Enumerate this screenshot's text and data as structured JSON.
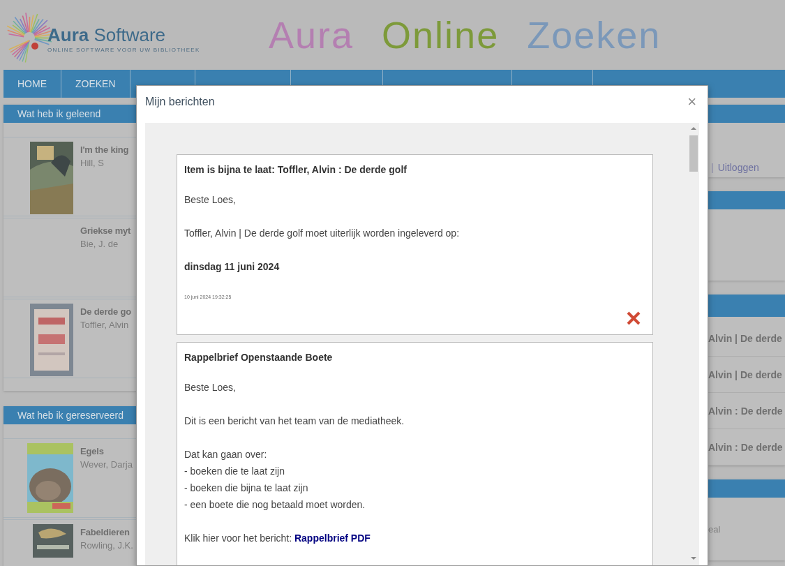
{
  "header": {
    "logo": {
      "name_bold": "Aura",
      "name_rest": "Software",
      "tagline": "ONLINE SOFTWARE VOOR UW BIBLIOTHEEK"
    },
    "banner": [
      {
        "word": "Aura",
        "color": "#b47fb1"
      },
      {
        "word": "Online",
        "color": "#7d9a3a"
      },
      {
        "word": "Zoeken",
        "color": "#7b98b9"
      }
    ]
  },
  "nav": {
    "items": [
      {
        "label": "HOME"
      },
      {
        "label": "ZOEKEN"
      }
    ]
  },
  "left_panels": [
    {
      "title": "Wat heb ik geleend",
      "items": [
        {
          "title": "I'm the king",
          "author": "Hill, S",
          "cover": true
        },
        {
          "title": "Griekse myt",
          "author": "Bie, J. de",
          "cover": false
        },
        {
          "title": "De derde go",
          "author": "Toffler, Alvin",
          "cover": true
        }
      ]
    },
    {
      "title": "Wat heb ik gereserveerd",
      "items": [
        {
          "title": "Egels",
          "author": "Wever, Darja",
          "cover": true
        },
        {
          "title": "Fabeldieren",
          "author": "Rowling, J.K.",
          "cover": true
        }
      ]
    }
  ],
  "right_panels": [
    {
      "kind": "links",
      "separator": "|",
      "link": "Uitloggen"
    },
    {
      "kind": "empty"
    },
    {
      "kind": "rows",
      "rows": [
        "Alvin | De derde",
        "Alvin | De derde",
        "Alvin : De derde",
        "Alvin : De derde"
      ]
    },
    {
      "kind": "note",
      "text": "eal"
    }
  ],
  "modal": {
    "title": "Mijn berichten",
    "close": "×",
    "messages": [
      {
        "title": "Item is bijna te laat: Toffler, Alvin : De derde golf",
        "deletable": true,
        "blocks": [
          {
            "kind": "text",
            "text": "Beste Loes,"
          },
          {
            "kind": "text",
            "text": "Toffler, Alvin | De derde golf moet uiterlijk worden ingeleverd op:"
          },
          {
            "kind": "bold",
            "text": "dinsdag 11 juni 2024"
          },
          {
            "kind": "timestamp",
            "text": "10 juni 2024 19:32:25"
          }
        ]
      },
      {
        "title": "Rappelbrief Openstaande Boete",
        "deletable": false,
        "blocks": [
          {
            "kind": "text",
            "text": "Beste Loes,"
          },
          {
            "kind": "text",
            "text": "Dit is een bericht van het team van de mediatheek."
          },
          {
            "kind": "lines",
            "lines": [
              "Dat kan gaan over:",
              "- boeken die te laat zijn",
              "- boeken die bijna te laat zijn",
              "- een boete die nog betaald moet worden."
            ]
          },
          {
            "kind": "link",
            "text": "Klik hier voor het bericht:",
            "link": "Rappelbrief PDF"
          }
        ]
      }
    ]
  }
}
